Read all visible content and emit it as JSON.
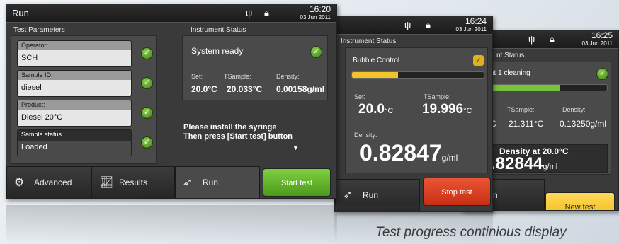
{
  "screen1": {
    "title": "Run",
    "time": "16:20",
    "date": "03 Jun 2011",
    "params_header": "Test Parameters",
    "operator_label": "Operator:",
    "operator_value": "SCH",
    "sample_id_label": "Sample ID:",
    "sample_id_value": "diesel",
    "product_label": "Product:",
    "product_value": "Diesel 20°C",
    "sample_status_label": "Sample status",
    "sample_status_value": "Loaded",
    "status_header": "Instrument Status",
    "status_text": "System ready",
    "set_label": "Set:",
    "tsample_label": "TSample:",
    "density_label": "Density:",
    "set_value": "20.0°C",
    "tsample_value": "20.033°C",
    "density_value": "0.00158g/ml",
    "instruction1": "Please install the syringe",
    "instruction2": "Then press [Start test] button",
    "tab_advanced": "Advanced",
    "tab_results": "Results",
    "tab_run": "Run",
    "start_btn": "Start test"
  },
  "screen2": {
    "time": "16:24",
    "date": "03 Jun 2011",
    "status_header": "Instrument Status",
    "bubble_label": "Bubble Control",
    "set_label": "Set:",
    "set_value": "20.0",
    "set_unit": "°C",
    "tsample_label": "TSample:",
    "tsample_value": "19.996",
    "tsample_unit": "°C",
    "density_label": "Density:",
    "density_value": "0.82847",
    "density_unit": "g/ml",
    "tab_run": "Run",
    "stop_btn": "Stop test"
  },
  "screen3": {
    "time": "16:25",
    "date": "03 Jun 2011",
    "status_header": "nt Status",
    "step_label": "at 1 cleaning",
    "tsample_label": "TSample:",
    "density_label": "Density:",
    "temp_prefix": "C",
    "tsample_value": "21.311°C",
    "density_value": "0.13250g/ml",
    "density_at_label": "Density at  20.0°C",
    "density_at_value": ".82844",
    "density_at_unit": "g/ml",
    "tab_run": "n",
    "new_btn": "New test"
  },
  "caption": "Test progress continious display",
  "colors": {
    "green_btn": "#5bb02a",
    "red_btn": "#d83a1c",
    "yellow_btn": "#f2c42a",
    "progress_yellow": "#f2c42a",
    "progress_green": "#79c33c"
  }
}
